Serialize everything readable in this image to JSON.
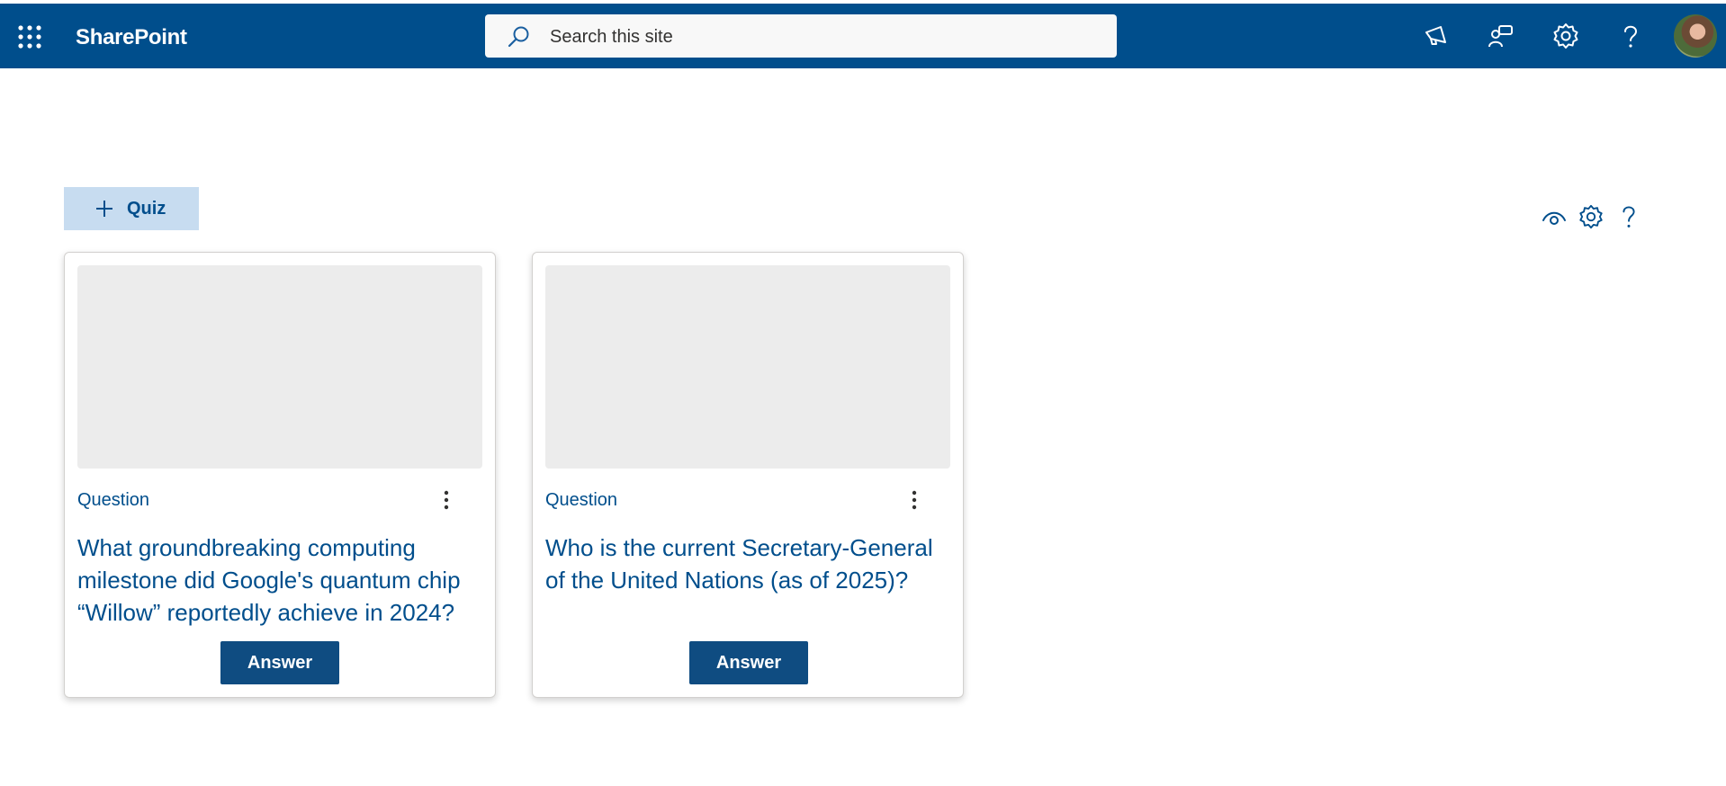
{
  "suite_bar": {
    "app_name": "SharePoint",
    "search_placeholder": "Search this site",
    "icons": [
      "app-launcher-icon",
      "search-icon",
      "megaphone-icon",
      "share-feedback-icon",
      "gear-icon",
      "help-icon",
      "avatar"
    ],
    "background_color": "#004e8c"
  },
  "toolbar": {
    "add_quiz_label": "Quiz",
    "icons": [
      "plus-icon",
      "eye-icon",
      "gear-icon",
      "help-icon"
    ]
  },
  "cards": [
    {
      "label": "Question",
      "question": "What groundbreaking computing milestone did Google's quantum chip “Willow” reportedly achieve in 2024?",
      "button": "Answer"
    },
    {
      "label": "Question",
      "question": "Who is the current Secretary-General of the United Nations (as of 2025)?",
      "button": "Answer"
    }
  ],
  "colors": {
    "accent": "#004e8c",
    "button": "#0f4c81",
    "quiz_button_bg": "#c7dcf0",
    "card_image_placeholder": "#ececec"
  }
}
